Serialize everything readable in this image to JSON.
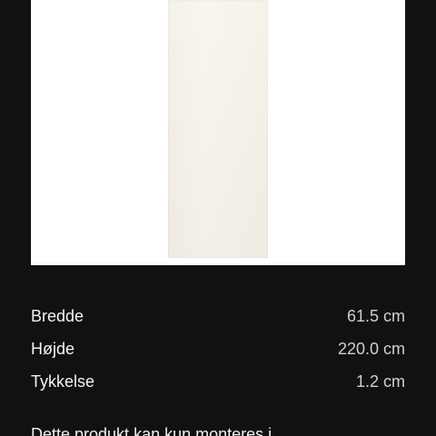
{
  "product_image": {
    "background_color": "#ffffff",
    "panel_color": "#f3efe6"
  },
  "specs": [
    {
      "label": "Bredde",
      "value": "61.5 cm"
    },
    {
      "label": "Højde",
      "value": "220.0 cm"
    },
    {
      "label": "Tykkelse",
      "value": "1.2 cm"
    }
  ],
  "description": {
    "text": "Dette produkt kan kun monteres i"
  }
}
